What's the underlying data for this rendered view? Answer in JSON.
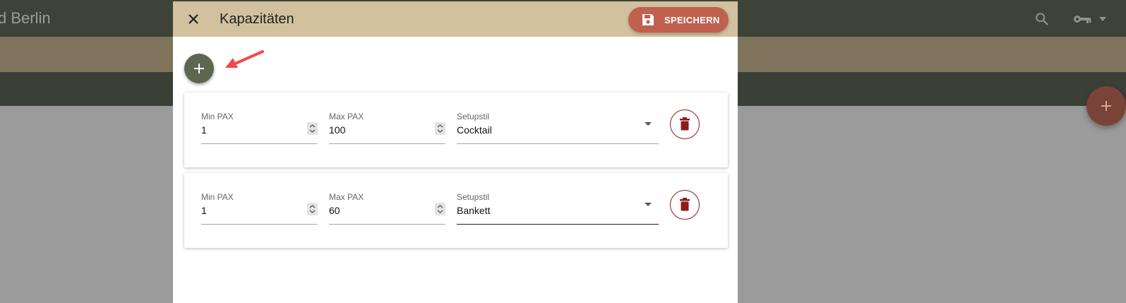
{
  "background": {
    "app_title": "d Berlin",
    "search_icon": "search-icon",
    "key_icon": "key-icon",
    "menu_caret_icon": "caret-down-icon",
    "fab_icon": "plus-icon"
  },
  "dialog": {
    "title": "Kapazitäten",
    "close_icon": "close-icon",
    "save": {
      "label": "SPEICHERN",
      "icon": "save-icon"
    },
    "add_icon": "plus-icon",
    "annotation": "red-arrow-pointing-to-add-button",
    "capacities": [
      {
        "min_pax": {
          "label": "Min PAX",
          "value": "1"
        },
        "max_pax": {
          "label": "Max PAX",
          "value": "100"
        },
        "setup": {
          "label": "Setupstil",
          "value": "Cocktail"
        },
        "delete_icon": "trash-icon"
      },
      {
        "min_pax": {
          "label": "Min PAX",
          "value": "1"
        },
        "max_pax": {
          "label": "Max PAX",
          "value": "60"
        },
        "setup": {
          "label": "Setupstil",
          "value": "Bankett"
        },
        "delete_icon": "trash-icon"
      }
    ]
  },
  "colors": {
    "header": "#d2c19e",
    "save_button": "#c0604f",
    "add_button": "#5d6750",
    "delete_accent": "#8e1b1b",
    "app_bar": "#3d4337",
    "arrow": "#f04a4a"
  }
}
